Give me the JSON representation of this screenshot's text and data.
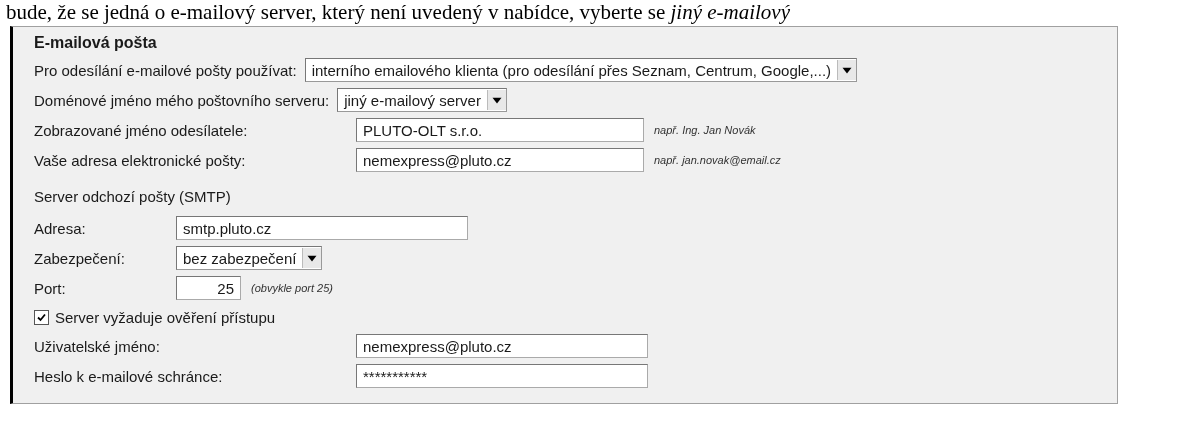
{
  "intro_text": "bude, že se jedná o e-mailový server, který není uvedený v nabídce, vyberte se *jiný e-mailový*",
  "section": {
    "title": "E-mailová pošta",
    "select_rows": [
      {
        "label": "Pro odesílání e-mailové pošty používat:",
        "value": "interního emailového klienta (pro odesílání přes Seznam, Centrum, Google,...)"
      },
      {
        "label": "Doménové jméno mého poštovního serveru:",
        "value": "jiný e-mailový server"
      }
    ],
    "sender_rows": [
      {
        "label": "Zobrazované jméno odesílatele:",
        "value": "PLUTO-OLT s.r.o.",
        "hint": "např. Ing. Jan Novák"
      },
      {
        "label": "Vaše adresa elektronické pošty:",
        "value": "nemexpress@pluto.cz",
        "hint": "např. jan.novak@email.cz"
      }
    ],
    "smtp": {
      "title": "Server odchozí pošty (SMTP)",
      "rows": [
        {
          "kind": "text",
          "label": "Adresa:",
          "value": "smtp.pluto.cz"
        },
        {
          "kind": "select",
          "label": "Zabezpečení:",
          "value": "bez zabezpečení"
        },
        {
          "kind": "number",
          "label": "Port:",
          "value": "25",
          "hint": "(obvykle port 25)"
        }
      ]
    },
    "auth": {
      "label": "Server vyžaduje ověření přístupu",
      "checked": true,
      "rows": [
        {
          "label": "Uživatelské jméno:",
          "value": "nemexpress@pluto.cz"
        },
        {
          "label": "Heslo k e-mailové schránce:",
          "value": "***********"
        }
      ]
    }
  }
}
